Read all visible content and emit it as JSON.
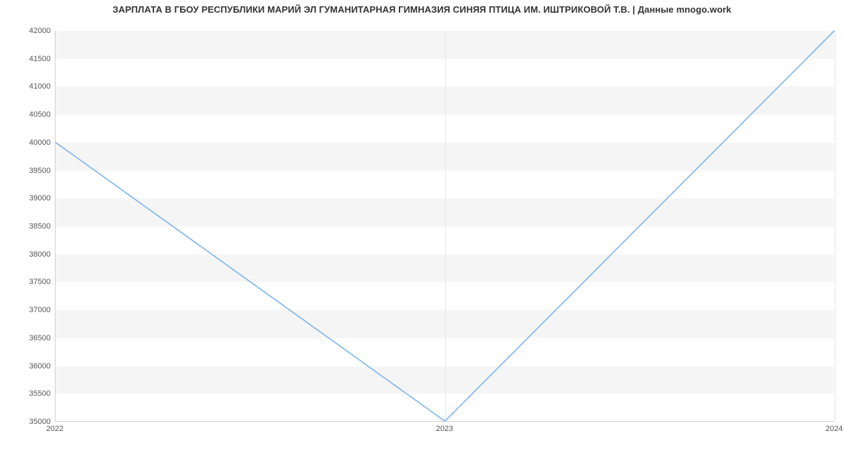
{
  "chart_data": {
    "type": "line",
    "title": "ЗАРПЛАТА В ГБОУ РЕСПУБЛИКИ МАРИЙ ЭЛ ГУМАНИТАРНАЯ ГИМНАЗИЯ СИНЯЯ ПТИЦА ИМ. ИШТРИКОВОЙ Т.В. | Данные mnogo.work",
    "x": [
      2022,
      2023,
      2024
    ],
    "values": [
      40000,
      35000,
      42000
    ],
    "xlabel": "",
    "ylabel": "",
    "ylim": [
      35000,
      42000
    ],
    "yticks": [
      35000,
      35500,
      36000,
      36500,
      37000,
      37500,
      38000,
      38500,
      39000,
      39500,
      40000,
      40500,
      41000,
      41500,
      42000
    ],
    "xticks": [
      2022,
      2023,
      2024
    ],
    "line_color": "#7cb5ec"
  }
}
